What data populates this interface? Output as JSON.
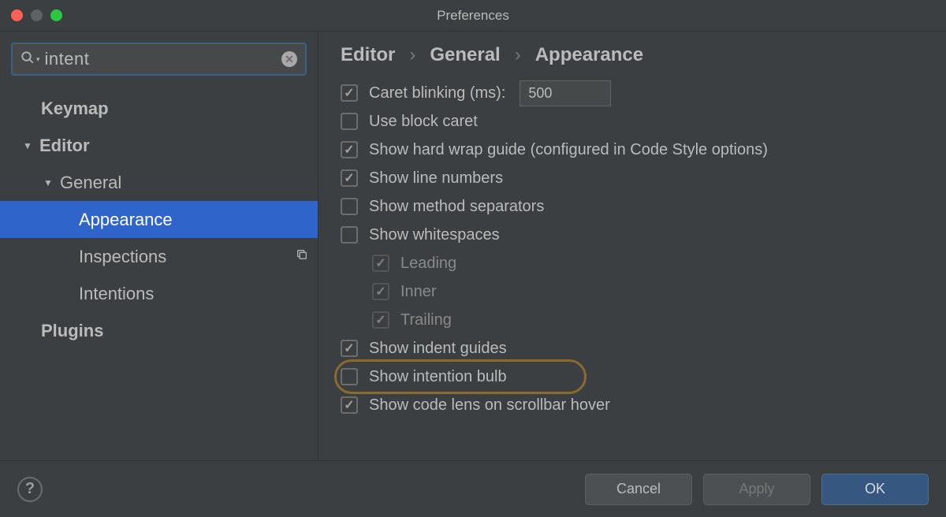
{
  "window": {
    "title": "Preferences"
  },
  "search": {
    "value": "intent"
  },
  "sidebar": {
    "items": [
      {
        "label": "Keymap"
      },
      {
        "label": "Editor"
      },
      {
        "label": "General"
      },
      {
        "label": "Appearance"
      },
      {
        "label": "Inspections"
      },
      {
        "label": "Intentions"
      },
      {
        "label": "Plugins"
      }
    ]
  },
  "breadcrumb": {
    "a": "Editor",
    "b": "General",
    "c": "Appearance"
  },
  "settings": {
    "caret_blinking": {
      "label": "Caret blinking (ms):",
      "value": "500"
    },
    "use_block_caret": "Use block caret",
    "hard_wrap": "Show hard wrap guide (configured in Code Style options)",
    "line_numbers": "Show line numbers",
    "method_sep": "Show method separators",
    "whitespaces": "Show whitespaces",
    "ws_leading": "Leading",
    "ws_inner": "Inner",
    "ws_trailing": "Trailing",
    "indent_guides": "Show indent guides",
    "intention_bulb": "Show intention bulb",
    "code_lens": "Show code lens on scrollbar hover"
  },
  "footer": {
    "cancel": "Cancel",
    "apply": "Apply",
    "ok": "OK"
  }
}
